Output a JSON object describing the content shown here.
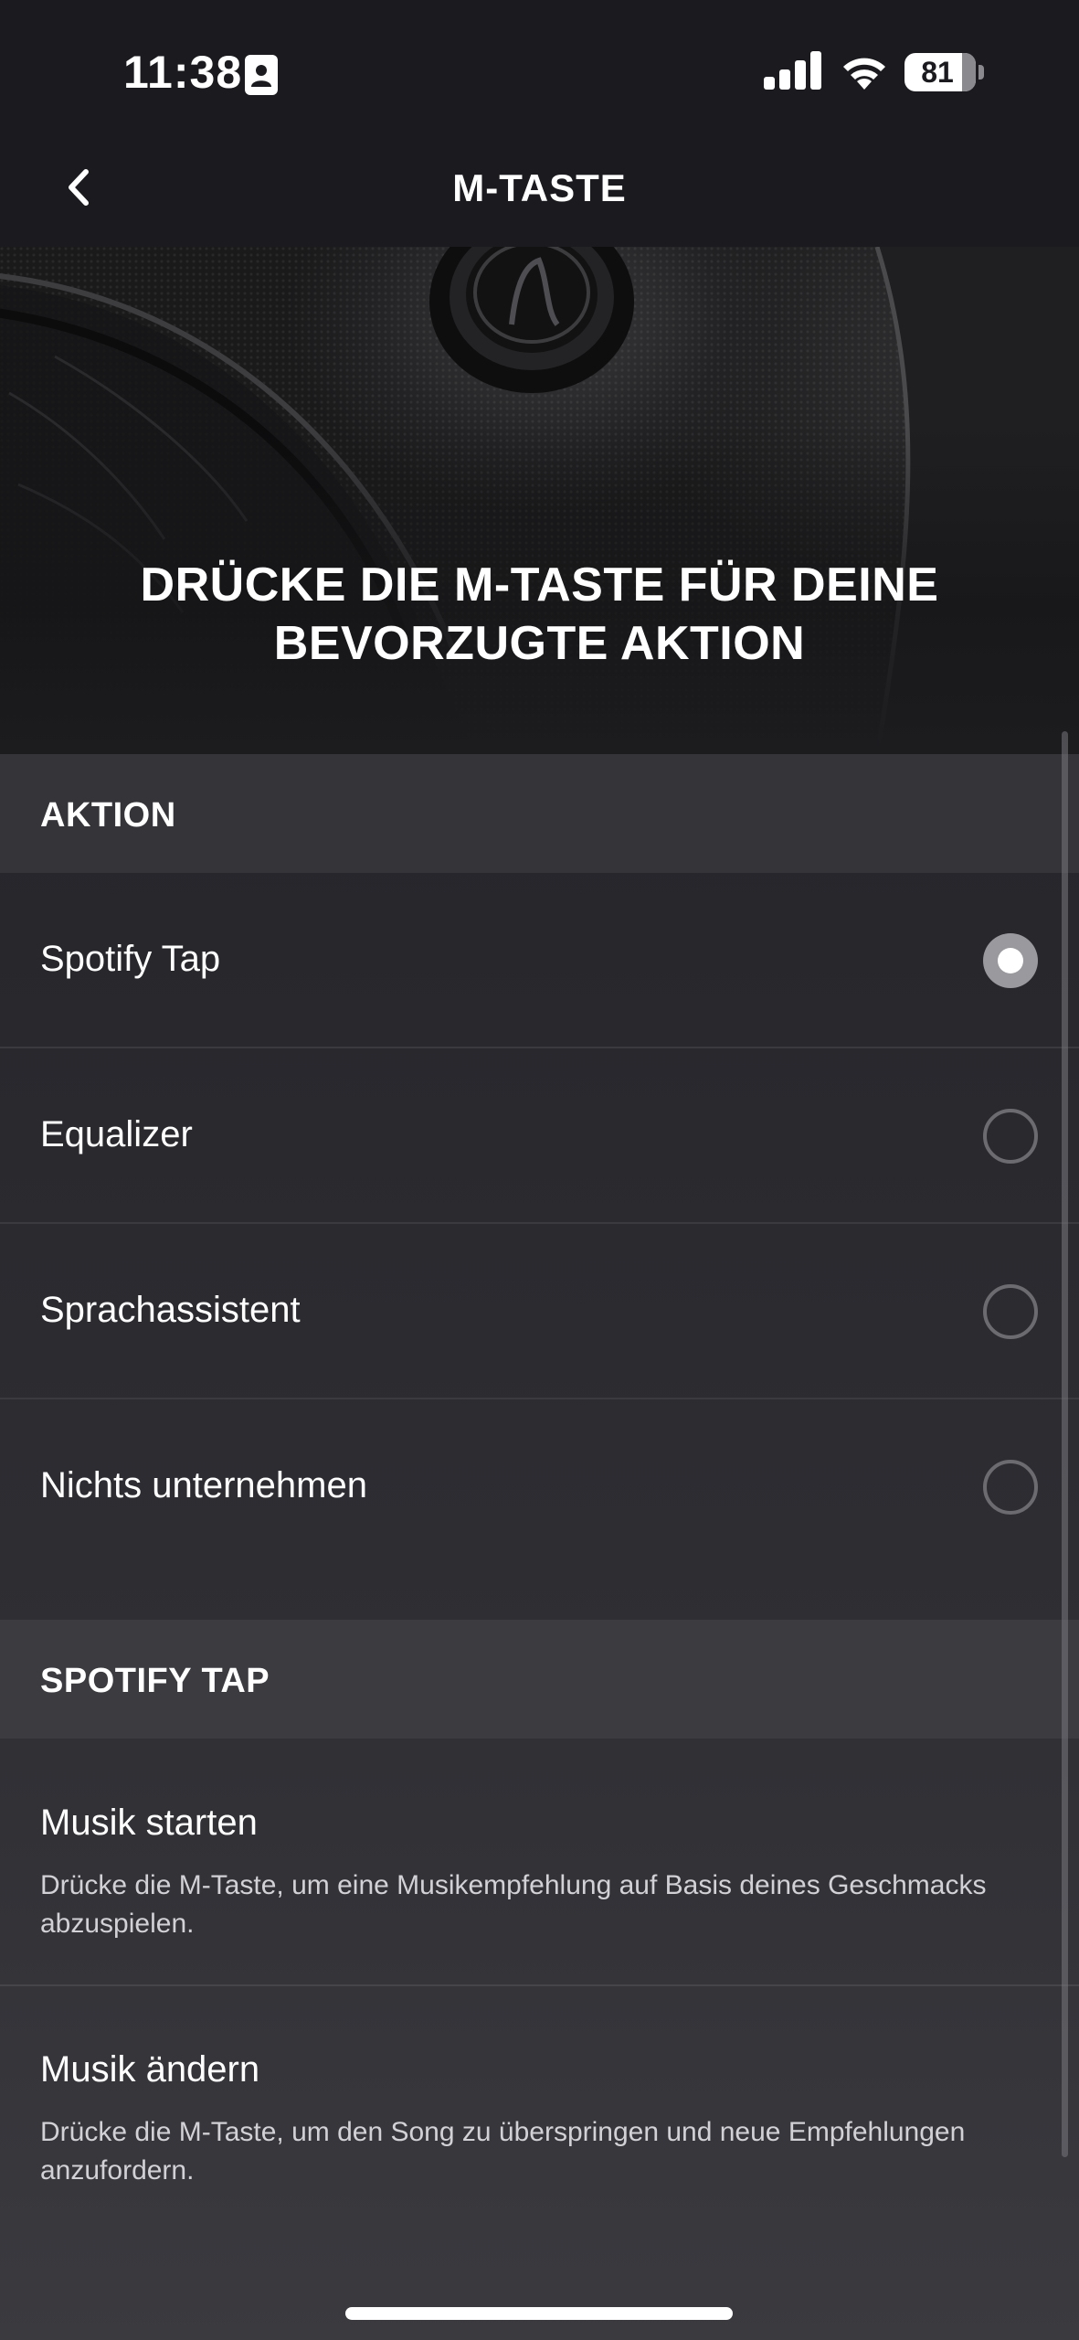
{
  "status_bar": {
    "time": "11:38",
    "battery_percent": "81",
    "battery_level": 0.81
  },
  "nav": {
    "title": "M-TASTE"
  },
  "hero": {
    "title": "DRÜCKE DIE M-TASTE FÜR DEINE BEVORZUGTE AKTION"
  },
  "action_section": {
    "header": "AKTION",
    "options": [
      {
        "label": "Spotify Tap",
        "selected": true
      },
      {
        "label": "Equalizer",
        "selected": false
      },
      {
        "label": "Sprachassistent",
        "selected": false
      },
      {
        "label": "Nichts unternehmen",
        "selected": false
      }
    ]
  },
  "spotify_section": {
    "header": "SPOTIFY TAP",
    "items": [
      {
        "title": "Musik starten",
        "description": "Drücke die M-Taste, um eine Musikempfehlung auf Basis deines Geschmacks abzuspielen."
      },
      {
        "title": "Musik ändern",
        "description": "Drücke die M-Taste, um den Song zu überspringen und neue Empfehlungen anzufordern."
      }
    ]
  }
}
